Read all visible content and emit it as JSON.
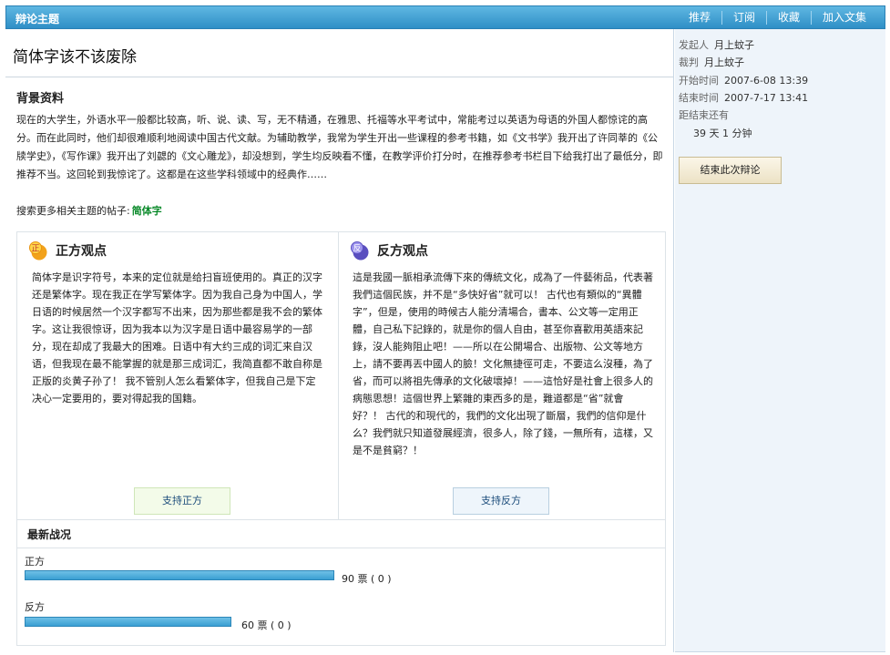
{
  "topbar": {
    "title": "辩论主题",
    "nav": [
      "推荐",
      "订阅",
      "收藏",
      "加入文集"
    ]
  },
  "subject": "简体字该不该废除",
  "background": {
    "title": "背景资料",
    "text": "现在的大学生，外语水平一般都比较高，听、说、读、写，无不精通，在雅思、托福等水平考试中，常能考过以英语为母语的外国人都惊诧的高分。而在此同时，他们却很难顺利地阅读中国古代文献。为辅助教学，我常为学生开出一些课程的参考书籍，如《文书学》我开出了许同莘的《公牍学史》，《写作课》我开出了刘勰的《文心雕龙》，却没想到，学生均反映看不懂，在教学评价打分时，在推荐参考书栏目下给我打出了最低分，即推荐不当。这回轮到我惊诧了。这都是在这些学科领域中的经典作……"
  },
  "more": {
    "label": "搜索更多相关主题的帖子:",
    "keyword": "简体字"
  },
  "pro": {
    "badge": "正",
    "label": "正方观点",
    "text": "简体字是识字符号，本来的定位就是给扫盲班使用的。真正的汉字还是繁体字。现在我正在学写繁体字。因为我自己身为中国人，学日语的时候居然一个汉字都写不出来，因为那些都是我不会的繁体字。这让我很惊讶，因为我本以为汉字是日语中最容易学的一部分，现在却成了我最大的困难。日语中有大约三成的词汇来自汉语，但我现在最不能掌握的就是那三成词汇，我简直都不敢自称是正版的炎黄子孙了！ 我不管别人怎么看繁体字，但我自己是下定决心一定要用的，要对得起我的国籍。",
    "button": "支持正方"
  },
  "con": {
    "badge": "反",
    "label": "反方观点",
    "text": "這是我國一脈相承流傳下來的傳統文化，成為了一件藝術品，代表著我們這個民族，并不是“多快好省”就可以！ 古代也有類似的“異體字”，但是，使用的時候古人能分清場合，書本、公文等一定用正體，自己私下記錄的，就是你的個人自由，甚至你喜歡用英語來記錄，沒人能夠阻止吧！——所以在公開場合、出版物、公文等地方上，請不要再丟中國人的臉！文化無捷徑可走，不要這么沒種，為了省，而可以將祖先傳承的文化破壞掉！——這恰好是社會上很多人的病態思想！這個世界上繁雜的東西多的是，難道都是“省”就會好？！ 古代的和現代的，我們的文化出現了斷層，我們的信仰是什么？我們就只知道發展經濟，很多人，除了錢，一無所有，這樣，又是不是貧窮？！",
    "button": "支持反方"
  },
  "status": {
    "title": "最新战况",
    "votes": [
      {
        "label": "正方",
        "count": 90,
        "value_text": "90 票 ( 0 )",
        "share": 0.6
      },
      {
        "label": "反方",
        "count": 60,
        "value_text": "60 票 ( 0 )",
        "share": 0.4
      }
    ]
  },
  "side": {
    "initiator_k": "发起人",
    "initiator_v": "月上蚊子",
    "judge_k": "裁判",
    "judge_v": "月上蚊子",
    "start_k": "开始时间",
    "start_v": "2007-6-08 13:39",
    "end_k": "结束时间",
    "end_v": "2007-7-17 13:41",
    "remain_k": "距结束还有",
    "remain_v": "39 天 1 分钟",
    "end_button": "结束此次辩论"
  },
  "colors": {
    "topbar": "#2f8fc6",
    "bar": "#3a9fd3",
    "keyword": "#0a8a2a",
    "sidebar": "#eef4fa"
  }
}
